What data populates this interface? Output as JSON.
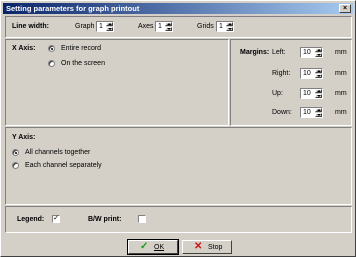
{
  "window": {
    "title": "Setting parameters for graph printout",
    "close_glyph": "×"
  },
  "line_width": {
    "label": "Line width:",
    "graph": {
      "label": "Graph",
      "value": "1"
    },
    "axes": {
      "label": "Axes",
      "value": "1"
    },
    "grids": {
      "label": "Grids",
      "value": "1"
    }
  },
  "x_axis": {
    "label": "X Axis:",
    "options": [
      {
        "label": "Entire record",
        "selected": true
      },
      {
        "label": "On the screen",
        "selected": false
      }
    ]
  },
  "margins": {
    "label": "Margins:",
    "unit": "mm",
    "left": {
      "label": "Left:",
      "value": "10"
    },
    "right": {
      "label": "Right:",
      "value": "10"
    },
    "up": {
      "label": "Up:",
      "value": "10"
    },
    "down": {
      "label": "Down:",
      "value": "10"
    }
  },
  "y_axis": {
    "label": "Y Axis:",
    "options": [
      {
        "label": "All channels together",
        "selected": true
      },
      {
        "label": "Each channel separately",
        "selected": false
      }
    ]
  },
  "legend": {
    "label": "Legend:",
    "checked": true,
    "check_glyph": "✓"
  },
  "bw_print": {
    "label": "B/W print:",
    "checked": false
  },
  "buttons": {
    "ok": {
      "label": "OK",
      "icon": "checkmark-icon",
      "color": "#1a9c1a"
    },
    "stop": {
      "label": "Stop",
      "icon": "x-icon",
      "color": "#d01010"
    }
  }
}
